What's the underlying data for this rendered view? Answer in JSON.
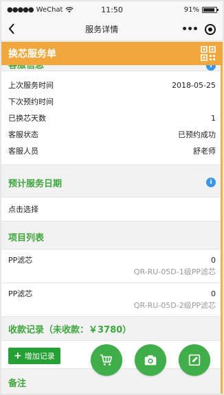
{
  "status_bar": {
    "carrier": "WeChat",
    "time": "11:50",
    "battery": "91%",
    "battery_level": 0.91
  },
  "nav": {
    "title": "服务详情"
  },
  "header": {
    "title": "换芯服务单",
    "color": "#f0a83e"
  },
  "customer_service": {
    "section_title": "客服信息",
    "rows": [
      {
        "label": "上次服务时间",
        "value": "2018-05-25"
      },
      {
        "label": "下次预约时间",
        "value": ""
      },
      {
        "label": "已换芯天数",
        "value": "1"
      },
      {
        "label": "客服状态",
        "value": "已预约成功"
      },
      {
        "label": "客服人员",
        "value": "舒老师"
      }
    ]
  },
  "planned_date": {
    "section_title": "预计服务日期",
    "placeholder": "点击选择"
  },
  "project_list": {
    "section_title": "项目列表",
    "items": [
      {
        "name": "PP滤芯",
        "qty": "0",
        "code": "QR-RU-05D-1级PP滤芯"
      },
      {
        "name": "PP滤芯",
        "qty": "0",
        "code": "QR-RU-05D-2级PP滤芯"
      }
    ]
  },
  "collection": {
    "section_title": "收款记录（未收款：￥3780）",
    "add_label": "增加记录"
  },
  "notes": {
    "section_title": "备注"
  },
  "colors": {
    "accent_green": "#3ca63c",
    "button_green": "#25a035",
    "info_blue": "#3a97e6"
  }
}
